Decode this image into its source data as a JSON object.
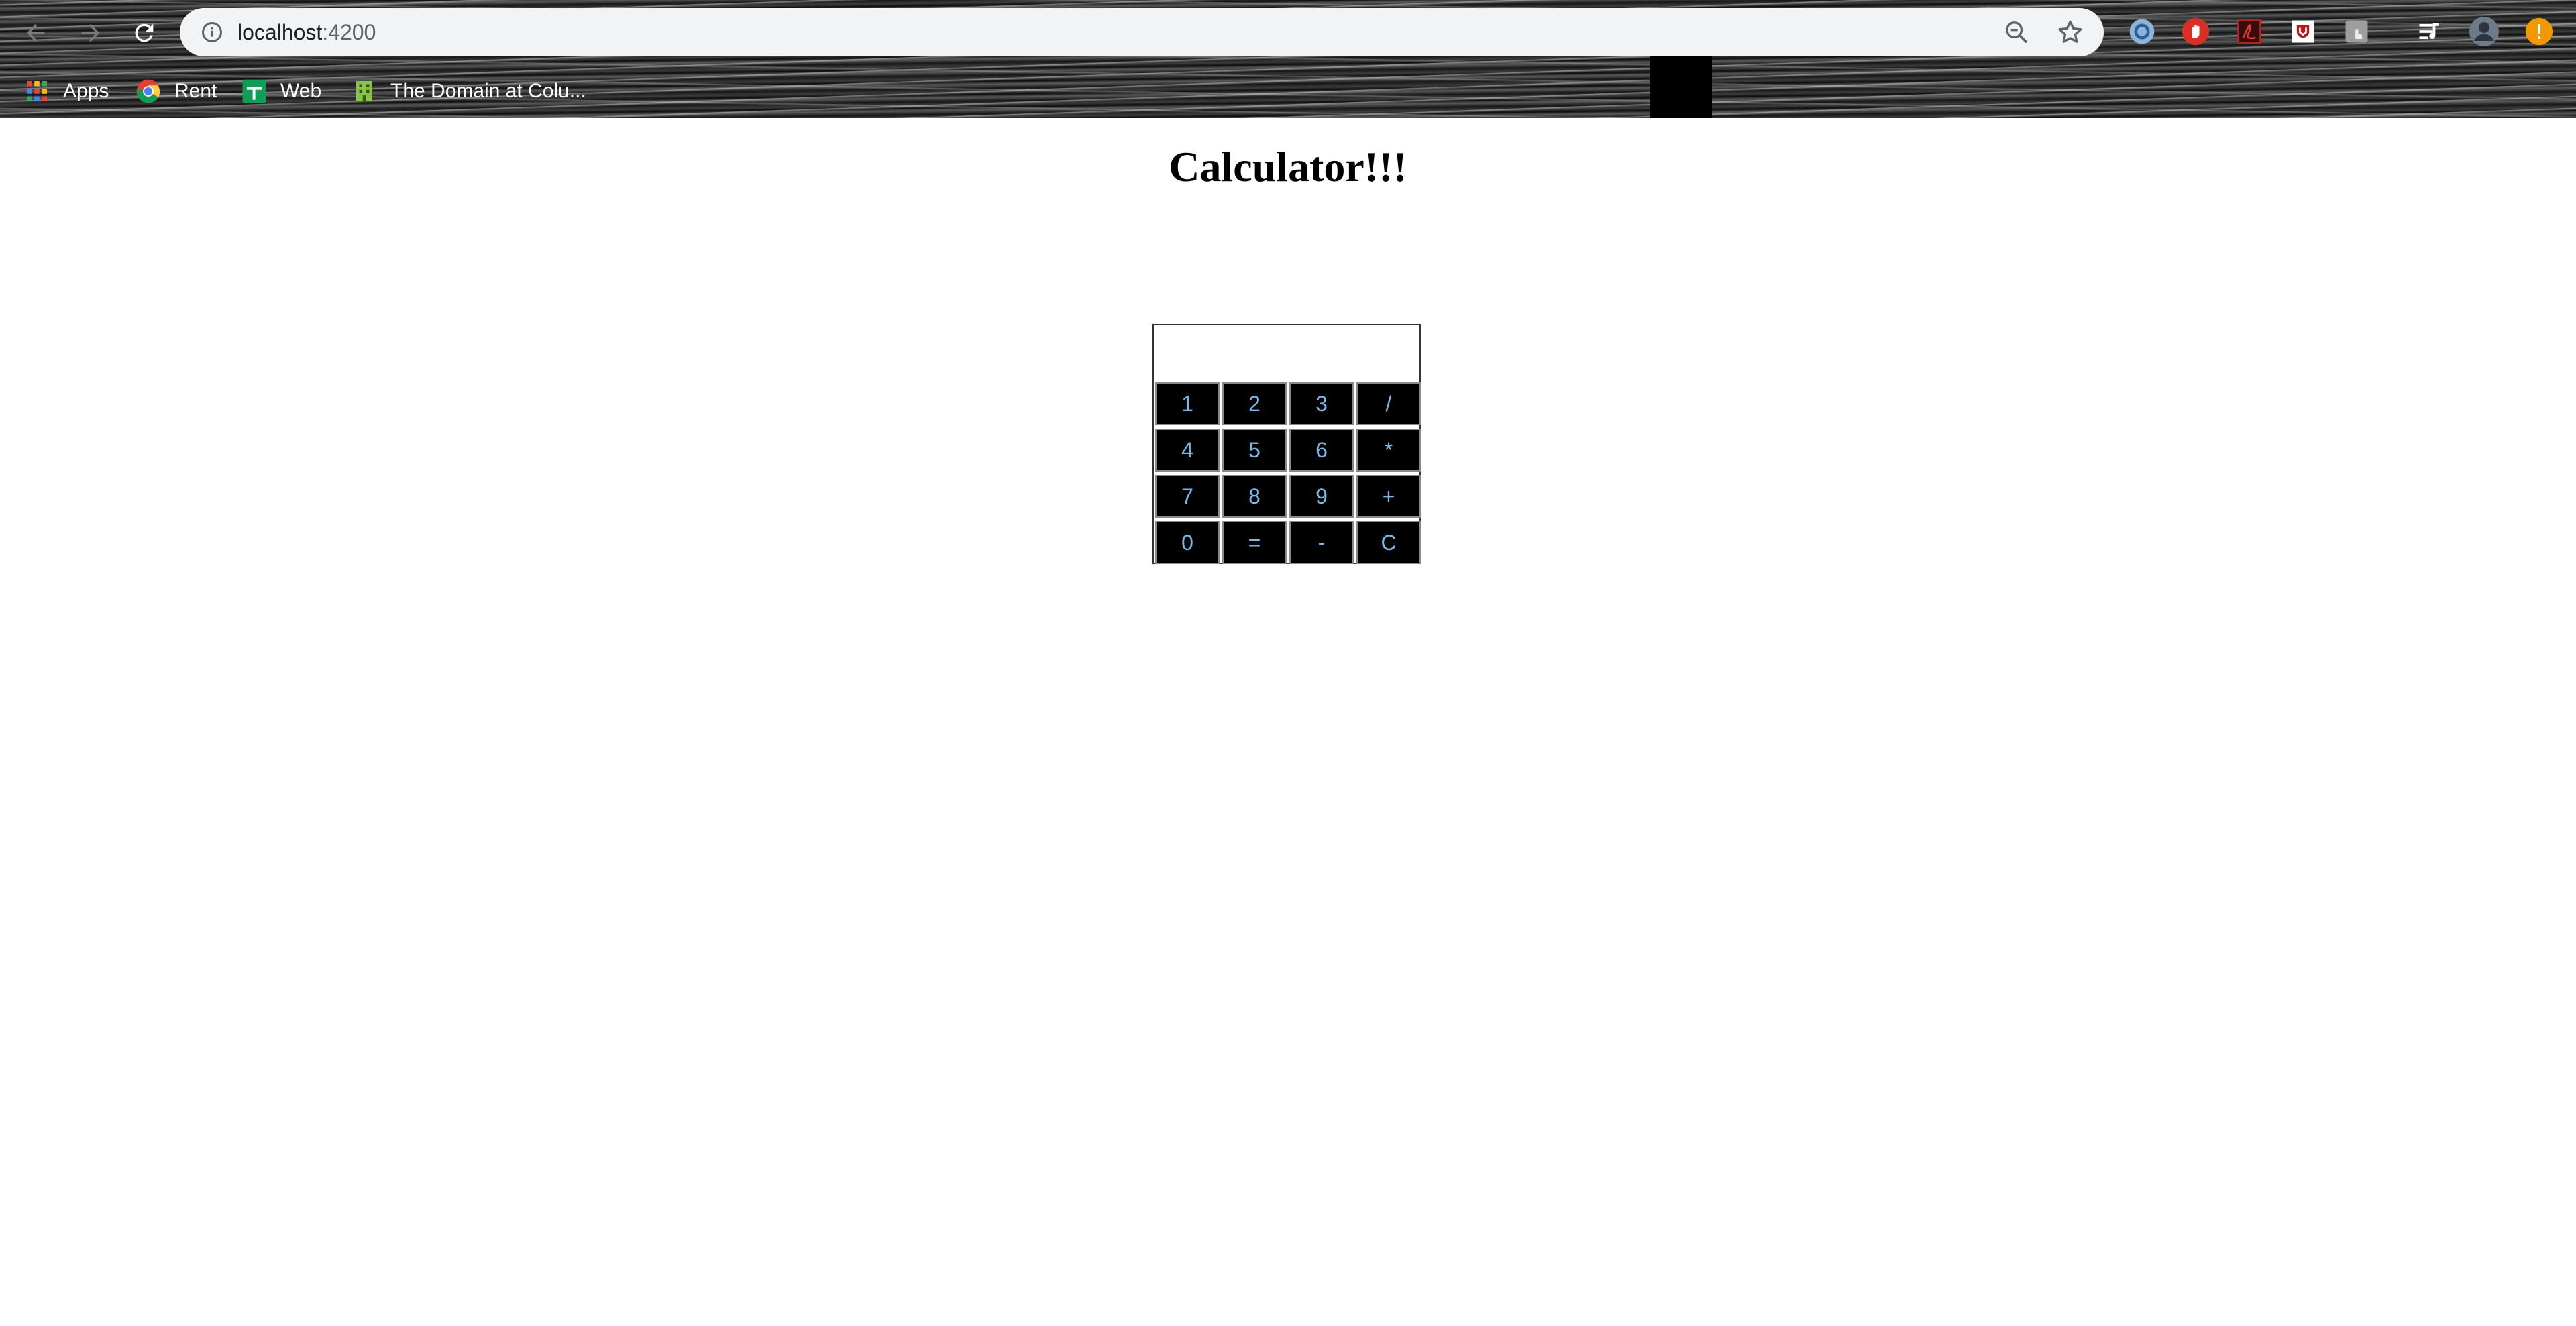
{
  "browser": {
    "url_host": "localhost",
    "url_port": ":4200",
    "bookmarks": [
      {
        "label": "Apps",
        "icon": "apps-grid-icon"
      },
      {
        "label": "Rent",
        "icon": "google-chrome-icon"
      },
      {
        "label": "Web",
        "icon": "green-plus-icon"
      },
      {
        "label": "The Domain at Colu...",
        "icon": "building-icon"
      }
    ],
    "extensions": [
      "ext-swirl-icon",
      "ext-hand-icon",
      "ext-pdf-icon",
      "ext-mcafee-icon",
      "ext-touch-icon",
      "media-queue-icon",
      "profile-avatar-icon",
      "update-alert-icon"
    ]
  },
  "page": {
    "title": "Calculator!!!"
  },
  "calculator": {
    "display_value": "",
    "keys": [
      [
        "1",
        "2",
        "3",
        "/"
      ],
      [
        "4",
        "5",
        "6",
        "*"
      ],
      [
        "7",
        "8",
        "9",
        "+"
      ],
      [
        "0",
        "=",
        "-",
        "C"
      ]
    ]
  },
  "colors": {
    "key_background": "#000000",
    "key_text": "#7ab8e6",
    "key_border": "#8a8a8a"
  }
}
